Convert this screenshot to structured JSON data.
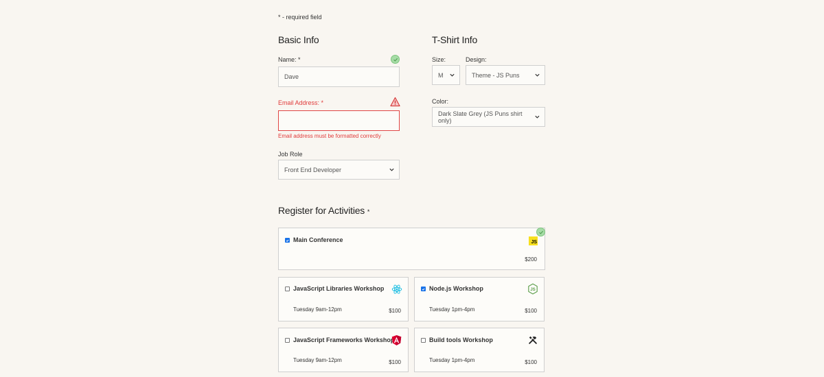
{
  "required_note": "* - required field",
  "basic_info": {
    "title": "Basic Info",
    "name_label": "Name:",
    "name_required": "*",
    "name_value": "Dave",
    "email_label": "Email Address:",
    "email_required": "*",
    "email_value": "",
    "email_error": "Email address must be formatted correctly",
    "job_role_label": "Job Role",
    "job_role_value": "Front End Developer"
  },
  "tshirt_info": {
    "title": "T-Shirt Info",
    "size_label": "Size:",
    "size_value": "M",
    "design_label": "Design:",
    "design_value": "Theme - JS Puns",
    "color_label": "Color:",
    "color_value": "Dark Slate Grey (JS Puns shirt only)"
  },
  "activities": {
    "title": "Register for Activities",
    "required": "*",
    "main": {
      "name": "Main Conference",
      "cost": "$200",
      "checked": true,
      "icon": "js-icon"
    },
    "items": [
      {
        "name": "JavaScript Libraries Workshop",
        "time": "Tuesday 9am-12pm",
        "cost": "$100",
        "checked": false,
        "icon": "react-icon"
      },
      {
        "name": "Node.js Workshop",
        "time": "Tuesday 1pm-4pm",
        "cost": "$100",
        "checked": true,
        "icon": "nodejs-icon"
      },
      {
        "name": "JavaScript Frameworks Workshop",
        "time": "Tuesday 9am-12pm",
        "cost": "$100",
        "checked": false,
        "icon": "angular-icon"
      },
      {
        "name": "Build tools Workshop",
        "time": "Tuesday 1pm-4pm",
        "cost": "$100",
        "checked": false,
        "icon": "tools-icon"
      }
    ]
  },
  "colors": {
    "background": "#f9f6f1",
    "error": "#e03a3a",
    "valid": "#a6dca6",
    "checkbox": "#1a73e8"
  }
}
